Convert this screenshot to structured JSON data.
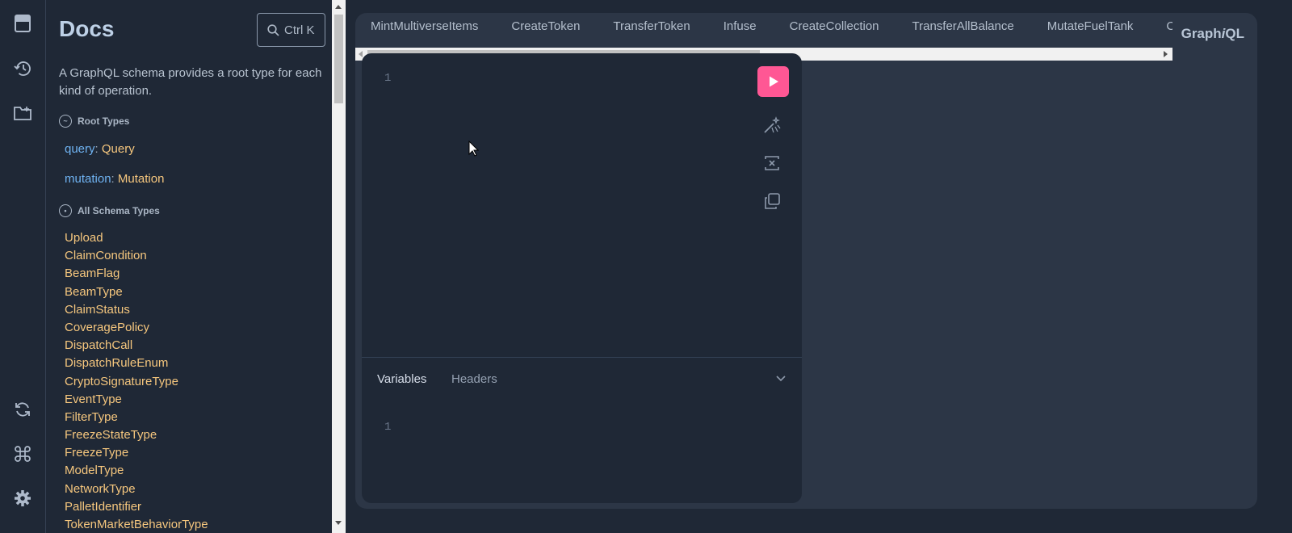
{
  "sidebar": {
    "icons": [
      "docs-icon",
      "history-icon",
      "collections-icon",
      "refetch-schema-icon",
      "shortcuts-icon",
      "settings-icon"
    ]
  },
  "docs": {
    "title": "Docs",
    "search_label": "Ctrl K",
    "description": "A GraphQL schema provides a root type for each kind of operation.",
    "root_types_heading": "Root Types",
    "root_types": [
      {
        "field": "query",
        "type": "Query"
      },
      {
        "field": "mutation",
        "type": "Mutation"
      }
    ],
    "all_types_heading": "All Schema Types",
    "types": [
      "Upload",
      "ClaimCondition",
      "BeamFlag",
      "BeamType",
      "ClaimStatus",
      "CoveragePolicy",
      "DispatchCall",
      "DispatchRuleEnum",
      "CryptoSignatureType",
      "EventType",
      "FilterType",
      "FreezeStateType",
      "FreezeType",
      "ModelType",
      "NetworkType",
      "PalletIdentifier",
      "TokenMarketBehaviorType"
    ]
  },
  "tabs": [
    "MintMultiverseItems",
    "CreateToken",
    "TransferToken",
    "Infuse",
    "CreateCollection",
    "TransferAllBalance",
    "MutateFuelTank",
    "C"
  ],
  "logo": {
    "prefix": "Graph",
    "italic": "i",
    "suffix": "QL"
  },
  "editor": {
    "line_number": "1",
    "variables_tab": "Variables",
    "headers_tab": "Headers",
    "variables_line_number": "1"
  },
  "colors": {
    "accent": "#ff5794",
    "type": "#f6c77e",
    "field": "#6fb3f2"
  }
}
